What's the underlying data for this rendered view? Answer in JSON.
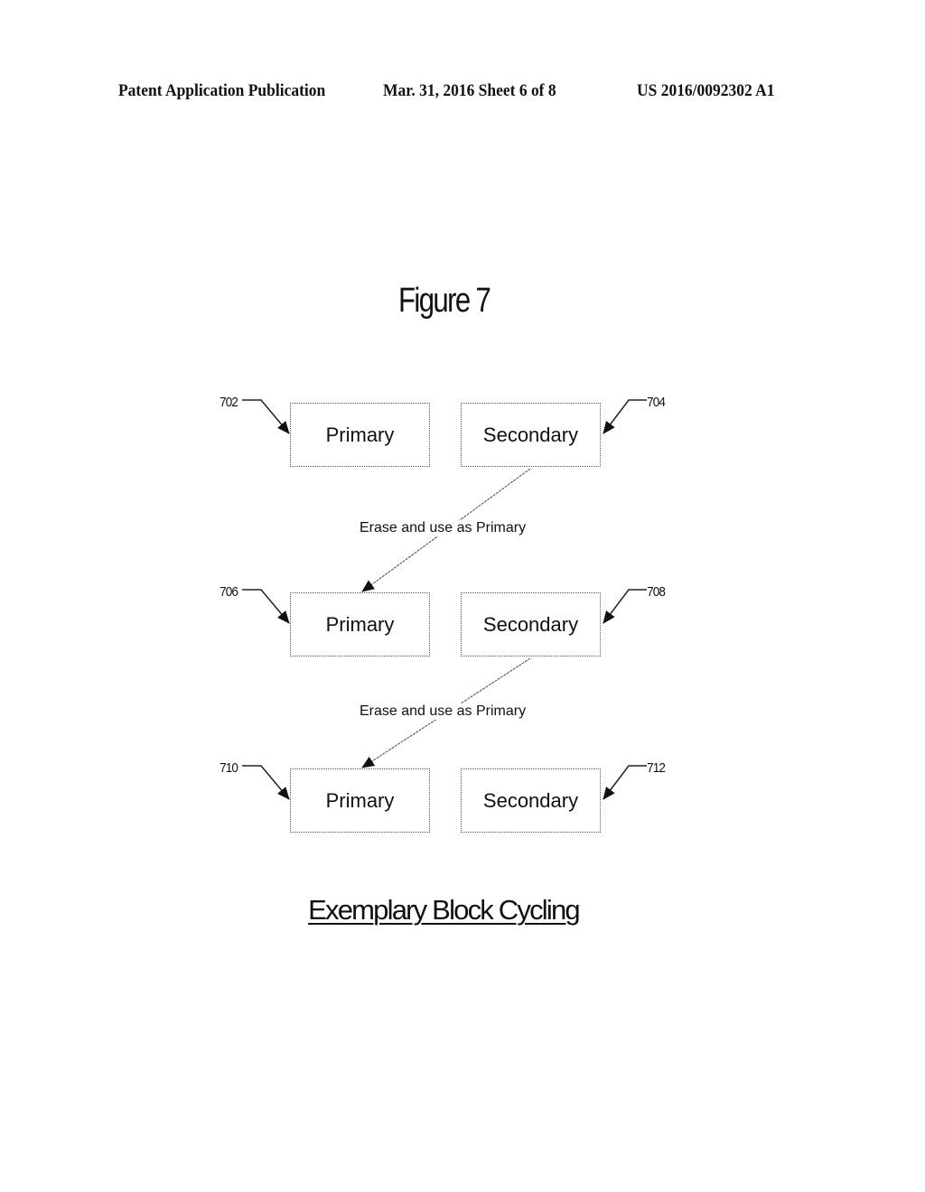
{
  "header": {
    "publication": "Patent Application Publication",
    "date_sheet": "Mar. 31, 2016  Sheet 6 of 8",
    "patent_number": "US 2016/0092302 A1"
  },
  "figure": {
    "title": "Figure 7",
    "caption": "Exemplary Block Cycling"
  },
  "rows": [
    {
      "primary": {
        "label": "Primary",
        "ref": "702"
      },
      "secondary": {
        "label": "Secondary",
        "ref": "704"
      }
    },
    {
      "primary": {
        "label": "Primary",
        "ref": "706"
      },
      "secondary": {
        "label": "Secondary",
        "ref": "708"
      }
    },
    {
      "primary": {
        "label": "Primary",
        "ref": "710"
      },
      "secondary": {
        "label": "Secondary",
        "ref": "712"
      }
    }
  ],
  "transitions": [
    {
      "from": "704",
      "to": "706",
      "label": "Erase and use as Primary"
    },
    {
      "from": "708",
      "to": "710",
      "label": "Erase and use as Primary"
    }
  ]
}
